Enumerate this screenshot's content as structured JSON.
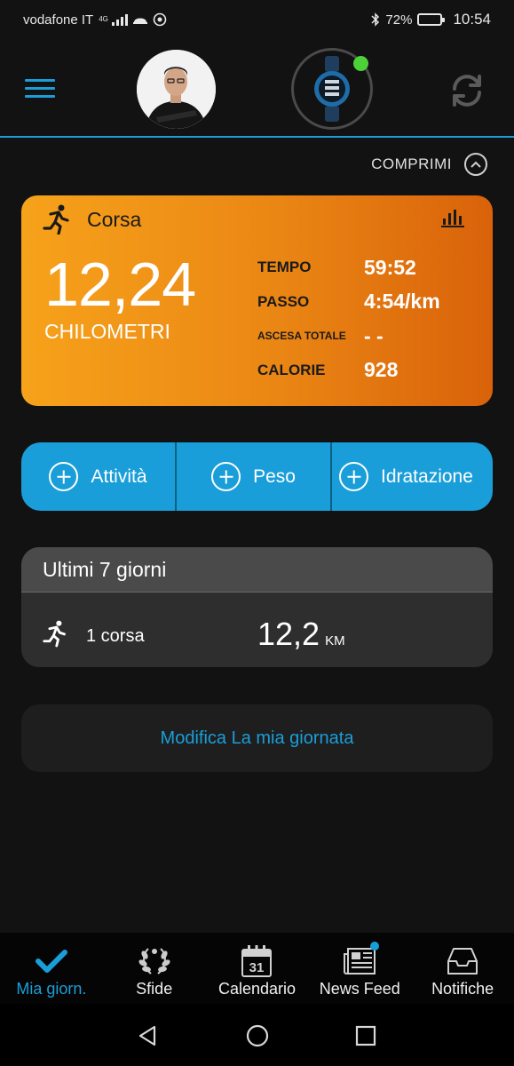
{
  "status_bar": {
    "carrier": "vodafone IT",
    "network": "4G",
    "battery": "72%",
    "time": "10:54"
  },
  "header": {
    "avatar_alt": "profile photo"
  },
  "collapse_label": "COMPRIMI",
  "activity": {
    "name": "Corsa",
    "big_value": "12,24",
    "big_unit": "CHILOMETRI",
    "stats": [
      {
        "label": "TEMPO",
        "value": "59:52"
      },
      {
        "label": "PASSO",
        "value": "4:54/km"
      },
      {
        "label": "ASCESA TOTALE",
        "value": "- -"
      },
      {
        "label": "CALORIE",
        "value": "928"
      }
    ]
  },
  "quick_add": [
    {
      "label": "Attività"
    },
    {
      "label": "Peso"
    },
    {
      "label": "Idratazione"
    }
  ],
  "week": {
    "title": "Ultimi 7 giorni",
    "count": "1 corsa",
    "distance": "12,2",
    "unit": "KM"
  },
  "edit_day_label": "Modifica La mia giornata",
  "bottom_nav": [
    {
      "label": "Mia giorn.",
      "icon": "check-icon",
      "active": true
    },
    {
      "label": "Sfide",
      "icon": "laurel-icon",
      "active": false
    },
    {
      "label": "Calendario",
      "icon": "calendar-icon",
      "calendar_day": "31",
      "active": false
    },
    {
      "label": "News Feed",
      "icon": "newspaper-icon",
      "active": false
    },
    {
      "label": "Notifiche",
      "icon": "inbox-icon",
      "active": false
    }
  ],
  "colors": {
    "accent": "#1a9ed9",
    "card_orange": "#f7a21b",
    "background": "#121212",
    "connected_dot": "#4cd137"
  }
}
